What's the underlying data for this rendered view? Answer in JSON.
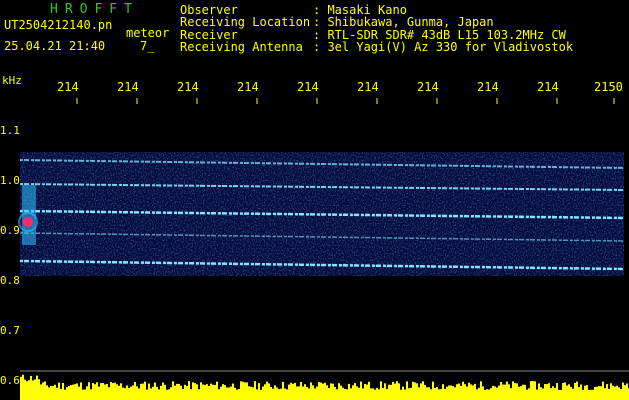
{
  "header": {
    "app_name": "HROFFT",
    "file_name": "UT2504212140.pn",
    "mode": "meteor",
    "timestamp": "25.04.21 21:40",
    "fraction": "7_",
    "info": [
      {
        "key": "Observer",
        "value": ": Masaki Kano"
      },
      {
        "key": "Receiving Location",
        "value": ": Shibukawa, Gunma, Japan"
      },
      {
        "key": "Receiver",
        "value": ": RTL-SDR SDR# 43dB L15 103.2MHz CW"
      },
      {
        "key": "Receiving Antenna",
        "value": ": 3el Yagi(V) Az 330 for Vladivostok"
      }
    ]
  },
  "axes": {
    "y_unit": "kHz",
    "y_ticks": [
      "1.1",
      "1.0",
      "0.9",
      "0.8",
      "0.7",
      "0.6"
    ],
    "x_ticks": [
      "214",
      "214",
      "214",
      "214",
      "214",
      "214",
      "214",
      "214",
      "214",
      "2150"
    ]
  },
  "colors": {
    "text": "#ffff00",
    "title": "#22cc22",
    "background": "#000000",
    "signal_low": "#0a1a8c",
    "signal_high": "#30c0ff",
    "echo": "#ff2a6a",
    "amplitude": "#ffff00"
  }
}
